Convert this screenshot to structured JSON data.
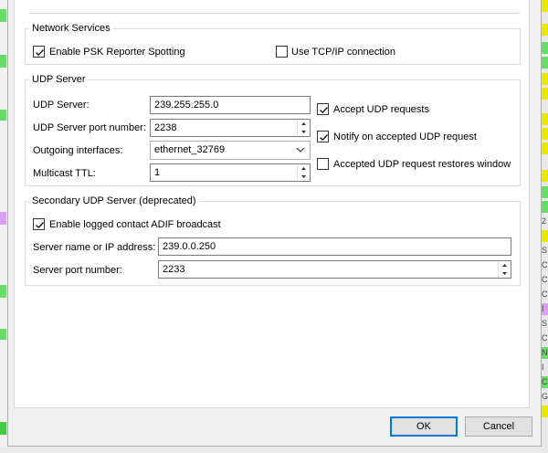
{
  "network_services": {
    "title": "Network Services",
    "psk_reporter": {
      "label": "Enable PSK Reporter Spotting",
      "checked": true
    },
    "tcp_ip": {
      "label": "Use TCP/IP connection",
      "checked": false
    }
  },
  "udp_server": {
    "title": "UDP Server",
    "server_label": "UDP Server:",
    "server_value": "239.255.255.0",
    "port_label": "UDP Server port number:",
    "port_value": "2238",
    "interfaces_label": "Outgoing interfaces:",
    "interfaces_value": "ethernet_32769",
    "ttl_label": "Multicast TTL:",
    "ttl_value": "1",
    "accept_requests": {
      "label": "Accept UDP requests",
      "checked": true
    },
    "notify_accepted": {
      "label": "Notify on accepted UDP request",
      "checked": true
    },
    "restores_window": {
      "label": "Accepted UDP request restores window",
      "checked": false
    }
  },
  "secondary_udp": {
    "title": "Secondary UDP Server (deprecated)",
    "adif_broadcast": {
      "label": "Enable logged contact ADIF broadcast",
      "checked": true
    },
    "server_label": "Server name or IP address:",
    "server_value": "239.0.0.250",
    "port_label": "Server port number:",
    "port_value": "2233"
  },
  "buttons": {
    "ok": "OK",
    "cancel": "Cancel"
  },
  "colors": {
    "accent": "#0078d7",
    "green_mark": "#4cd964",
    "yellow_mark": "#e8e800",
    "purple_mark": "#d9a0f0"
  },
  "background_fragments": [
    "2",
    "S",
    "C",
    "C",
    "C",
    "I",
    "S",
    "C",
    "N",
    "I",
    "C",
    "G"
  ]
}
